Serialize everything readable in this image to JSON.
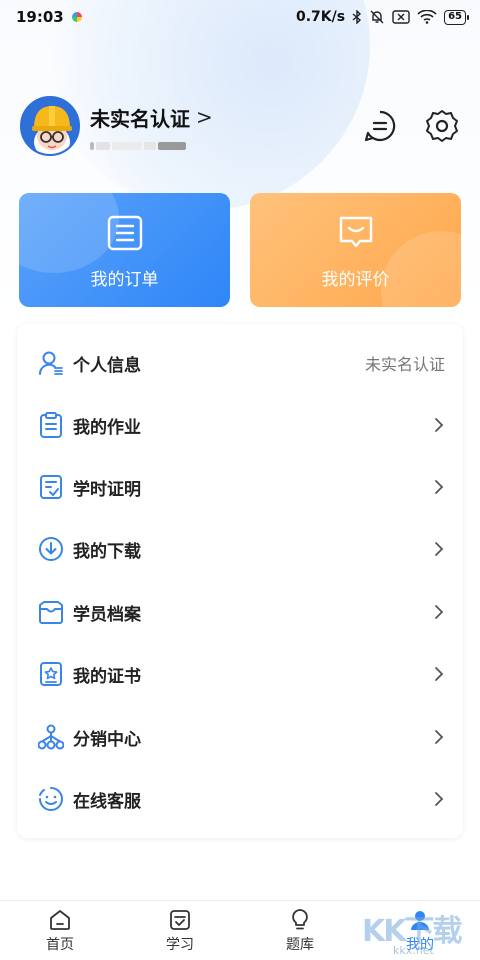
{
  "status_bar": {
    "time": "19:03",
    "net_speed": "0.7K/s",
    "battery": "65"
  },
  "profile": {
    "name": "未实名认证",
    "chevron": ">"
  },
  "cards": {
    "orders_label": "我的订单",
    "reviews_label": "我的评价"
  },
  "menu": {
    "items": [
      {
        "label": "个人信息",
        "value": "未实名认证",
        "icon": "person-info-icon"
      },
      {
        "label": "我的作业",
        "icon": "clipboard-icon"
      },
      {
        "label": "学时证明",
        "icon": "certificate-check-icon"
      },
      {
        "label": "我的下载",
        "icon": "download-icon"
      },
      {
        "label": "学员档案",
        "icon": "archive-box-icon"
      },
      {
        "label": "我的证书",
        "icon": "badge-star-icon"
      },
      {
        "label": "分销中心",
        "icon": "network-icon"
      },
      {
        "label": "在线客服",
        "icon": "smile-support-icon"
      }
    ]
  },
  "bottom_nav": {
    "items": [
      {
        "label": "首页",
        "icon": "home-icon"
      },
      {
        "label": "学习",
        "icon": "study-icon"
      },
      {
        "label": "题库",
        "icon": "bulb-icon"
      },
      {
        "label": "我的",
        "icon": "profile-icon"
      }
    ],
    "active_index": 3
  },
  "watermark": {
    "text": "KK下载",
    "sub": "kkx.net"
  },
  "colors": {
    "primary": "#2f86f7",
    "orange": "#ffa74a",
    "icon_blue": "#3a86e8"
  }
}
